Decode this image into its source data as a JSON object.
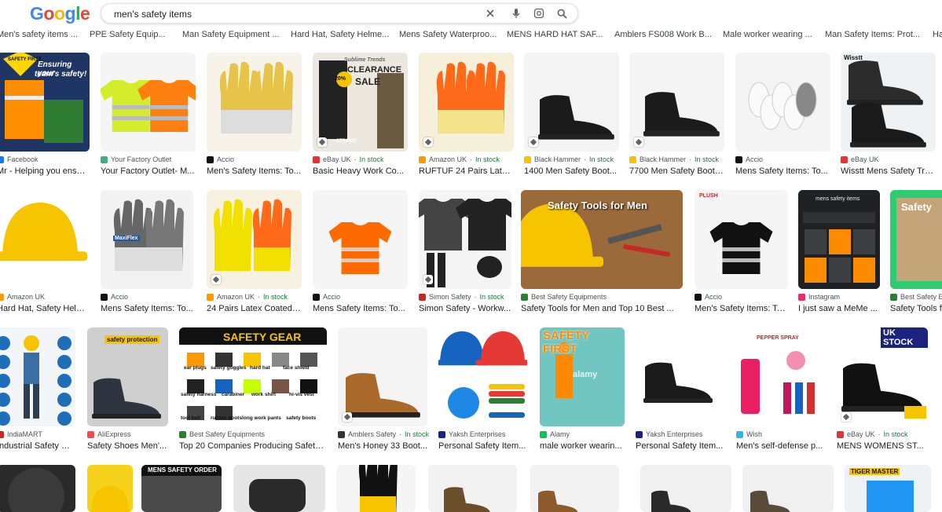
{
  "logo": "Google",
  "search": {
    "query": "men's safety items"
  },
  "chips": [
    "Men's safety items ...",
    "PPE Safety Equip...",
    "Man Safety Equipment ...",
    "Hard Hat, Safety Helme...",
    "Mens Safety Waterproo...",
    "MENS HARD HAT SAF...",
    "Amblers FS008 Work B...",
    "Male worker wearing ...",
    "Man Safety Items: Prot...",
    "Ha"
  ],
  "rows": [
    [
      {
        "source": "Facebook",
        "title": "Mr - Helping you ensur...",
        "stock": "",
        "color": "#1877f2",
        "bg": "#2c3e62",
        "overlay": [
          "Ensuring your",
          "team's safety!",
          "SAFETY FIRST"
        ]
      },
      {
        "source": "Your Factory Outlet",
        "title": "Your Factory Outlet- M...",
        "stock": "",
        "color": "#4a8",
        "bg": "#f5f5f5",
        "overlay": []
      },
      {
        "source": "Accio",
        "title": "Men's Safety Items: To...",
        "stock": "",
        "color": "#111",
        "bg": "#f7f3e8",
        "overlay": []
      },
      {
        "source": "eBay UK",
        "title": "Basic Heavy Work Co...",
        "stock": "In stock",
        "color": "#e53238",
        "bg": "#ece8df",
        "overlay": [
          "Sublime Trends",
          "CLEARANCE",
          "SALE",
          "20%",
          "STRONG"
        ]
      },
      {
        "source": "Amazon UK",
        "title": "RUFTUF 24 Pairs Late...",
        "stock": "In stock",
        "color": "#ff9900",
        "bg": "#f6efd9",
        "overlay": []
      },
      {
        "source": "Black Hammer",
        "title": "1400 Men Safety Boot...",
        "stock": "In stock",
        "color": "#f5c400",
        "bg": "#f4f4f4",
        "overlay": []
      },
      {
        "source": "Black Hammer",
        "title": "7700 Men Safety Boot ...",
        "stock": "In stock",
        "color": "#f5c400",
        "bg": "#f4f4f4",
        "overlay": []
      },
      {
        "source": "Accio",
        "title": "Mens Safety Items: To...",
        "stock": "",
        "color": "#111",
        "bg": "#f4f4f4",
        "overlay": []
      },
      {
        "source": "eBay UK",
        "title": "Wisstt Mens Safety Tra...",
        "stock": "",
        "color": "#e53238",
        "bg": "#eef2f4",
        "overlay": [
          "Wisstt"
        ]
      }
    ],
    [
      {
        "source": "Amazon UK",
        "title": "Hard Hat, Safety Helm...",
        "stock": "",
        "color": "#ff9900",
        "bg": "#fff",
        "overlay": []
      },
      {
        "source": "Accio",
        "title": "Mens Safety Items: To...",
        "stock": "",
        "color": "#111",
        "bg": "#f2f2f2",
        "overlay": [
          "MaxiFlex"
        ]
      },
      {
        "source": "Amazon UK",
        "title": "24 Pairs Latex Coated ...",
        "stock": "In stock",
        "color": "#ff9900",
        "bg": "#f6f1e0",
        "overlay": []
      },
      {
        "source": "Accio",
        "title": "Mens Safety Items: To...",
        "stock": "",
        "color": "#111",
        "bg": "#f5f5f5",
        "overlay": []
      },
      {
        "source": "Simon Safety",
        "title": "Simon Safety - Workw...",
        "stock": "In stock",
        "color": "#c62828",
        "bg": "#f5f5f5",
        "overlay": []
      },
      {
        "source": "Best Safety Equipments",
        "title": "Safety Tools for Men and Top 10 Best ...",
        "stock": "",
        "color": "#2e7d32",
        "bg": "#8a5a2b",
        "overlay": [
          "Safety Tools for Men"
        ]
      },
      {
        "source": "Accio",
        "title": "Men's Safety Items: To...",
        "stock": "",
        "color": "#111",
        "bg": "#f5f5f5",
        "overlay": [
          "PLUSH"
        ]
      },
      {
        "source": "Instagram",
        "title": "I just saw a MeMe ...",
        "stock": "",
        "color": "#e1306c",
        "bg": "#202124",
        "overlay": [
          "mens safety items"
        ]
      },
      {
        "source": "Best Safety E",
        "title": "Safety Tools fo",
        "stock": "",
        "color": "#2e7d32",
        "bg": "#2ecc71",
        "overlay": [
          "Safety"
        ]
      }
    ],
    [
      {
        "source": "IndiaMART",
        "title": "Industrial Safety Pr...",
        "stock": "",
        "color": "#c62828",
        "bg": "#f3f6f8",
        "overlay": []
      },
      {
        "source": "AliExpress",
        "title": "Safety Shoes Men'...",
        "stock": "",
        "color": "#ff4747",
        "bg": "#cfcfcf",
        "overlay": [
          "safety protection"
        ]
      },
      {
        "source": "Best Safety Equipments",
        "title": "Top 20 Companies Producing Safety ...",
        "stock": "",
        "color": "#2e7d32",
        "bg": "#fff",
        "overlay": [
          "SAFETY GEAR",
          "ear plugs",
          "safety goggles",
          "hard hat",
          "face shield",
          "safety harness",
          "carabiner",
          "work shirt",
          "hi-vis vest",
          "tool belt",
          "rubber boots",
          "long work pants",
          "safety boots"
        ]
      },
      {
        "source": "Amblers Safety",
        "title": "Men's Honey 33 Boot...",
        "stock": "In stock",
        "color": "#333",
        "bg": "#f4f4f4",
        "overlay": []
      },
      {
        "source": "Yaksh Enterprises",
        "title": "Personal Safety Item...",
        "stock": "",
        "color": "#1a237e",
        "bg": "#fff",
        "overlay": []
      },
      {
        "source": "Alamy",
        "title": "male worker wearin...",
        "stock": "",
        "color": "#00c853",
        "bg": "#72c6c2",
        "overlay": [
          "SAFETY FIRST",
          "alamy"
        ]
      },
      {
        "source": "Yaksh Enterprises",
        "title": "Personal Safety Item...",
        "stock": "",
        "color": "#1a237e",
        "bg": "#fff",
        "overlay": []
      },
      {
        "source": "Wish",
        "title": "Men's self-defense p...",
        "stock": "",
        "color": "#2fb7ec",
        "bg": "#fff",
        "overlay": [
          "PEPPER SPRAY"
        ]
      },
      {
        "source": "eBay UK",
        "title": "MENS WOMENS ST...",
        "stock": "In stock",
        "color": "#e53238",
        "bg": "#fff",
        "overlay": [
          "UK STOCK"
        ]
      }
    ],
    [
      {
        "source": "",
        "title": "",
        "stock": "",
        "color": "#000",
        "bg": "#2a2a2a",
        "overlay": []
      },
      {
        "source": "",
        "title": "",
        "stock": "",
        "color": "#000",
        "bg": "#f6d21a",
        "overlay": []
      },
      {
        "source": "",
        "title": "",
        "stock": "",
        "color": "#000",
        "bg": "#4a4a4a",
        "overlay": [
          "MENS SAFETY ORDER"
        ]
      },
      {
        "source": "",
        "title": "",
        "stock": "",
        "color": "#000",
        "bg": "#e6e6e6",
        "overlay": []
      },
      {
        "source": "",
        "title": "",
        "stock": "",
        "color": "#000",
        "bg": "#f5f5f5",
        "overlay": []
      },
      {
        "source": "",
        "title": "",
        "stock": "",
        "color": "#000",
        "bg": "#f2f2f2",
        "overlay": []
      },
      {
        "source": "",
        "title": "",
        "stock": "",
        "color": "#000",
        "bg": "#f2f2f2",
        "overlay": []
      },
      {
        "source": "",
        "title": "",
        "stock": "",
        "color": "#000",
        "bg": "#f0f0f0",
        "overlay": []
      },
      {
        "source": "",
        "title": "",
        "stock": "",
        "color": "#000",
        "bg": "#f0f0f0",
        "overlay": []
      },
      {
        "source": "",
        "title": "",
        "stock": "",
        "color": "#000",
        "bg": "#eef2f6",
        "overlay": [
          "TIGER MASTER"
        ]
      }
    ]
  ]
}
